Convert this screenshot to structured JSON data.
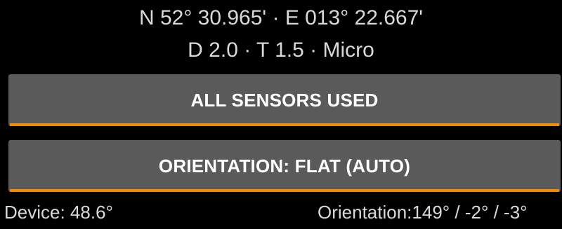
{
  "header": {
    "coordinates": "N 52° 30.965' · E 013° 22.667'",
    "details": "D 2.0 · T 1.5 · Micro"
  },
  "buttons": {
    "sensors_label": "ALL SENSORS USED",
    "orientation_label": "ORIENTATION: FLAT (AUTO)"
  },
  "status": {
    "device": "Device: 48.6°",
    "orientation": "Orientation:149° /  -2° /  -3°"
  },
  "colors": {
    "background": "#000000",
    "button": "#5a5a5a",
    "accent": "#f08c00",
    "text": "#d9d9d9"
  }
}
